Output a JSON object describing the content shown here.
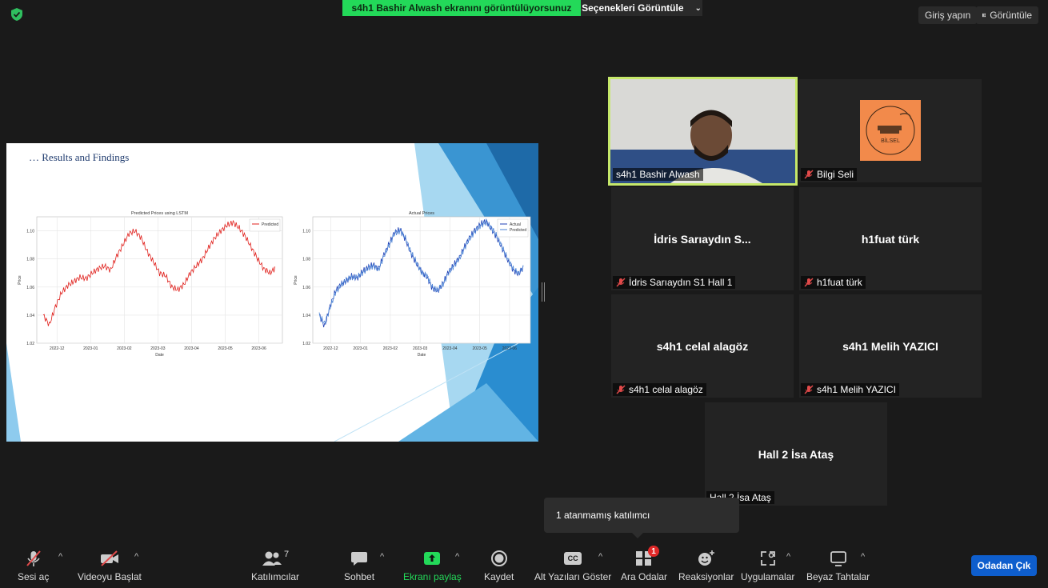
{
  "topbar": {
    "share_banner": "s4h1 Bashir Alwash ekranını görüntülüyorsunuz",
    "view_options": "Seçenekleri Görüntüle",
    "login": "Giriş yapın",
    "view": "Görüntüle"
  },
  "slide": {
    "title": "… Results and Findings",
    "chart_data": [
      {
        "type": "line",
        "title": "Predicted Prices using LSTM",
        "xlabel": "Date",
        "ylabel": "Price",
        "x_ticks": [
          "2022-12",
          "2023-01",
          "2023-02",
          "2023-03",
          "2023-04",
          "2023-05",
          "2023-06"
        ],
        "y_ticks": [
          "1.02",
          "1.04",
          "1.06",
          "1.08",
          "1.10"
        ],
        "ylim": [
          1.02,
          1.11
        ],
        "legend": [
          "Predicted"
        ],
        "legend_position": "top-right",
        "grid": true,
        "series": [
          {
            "name": "Predicted",
            "color": "#e0201c",
            "values": [
              1.04,
              1.033,
              1.046,
              1.056,
              1.061,
              1.064,
              1.067,
              1.066,
              1.07,
              1.073,
              1.075,
              1.072,
              1.082,
              1.09,
              1.098,
              1.1,
              1.095,
              1.085,
              1.078,
              1.07,
              1.068,
              1.06,
              1.058,
              1.062,
              1.07,
              1.075,
              1.08,
              1.088,
              1.095,
              1.1,
              1.104,
              1.106,
              1.102,
              1.096,
              1.088,
              1.08,
              1.073,
              1.07,
              1.074
            ]
          }
        ]
      },
      {
        "type": "line",
        "title": "Actual Prices",
        "xlabel": "Date",
        "ylabel": "Price",
        "x_ticks": [
          "2022-12",
          "2023-01",
          "2023-02",
          "2023-03",
          "2023-04",
          "2023-05",
          "2023-06"
        ],
        "y_ticks": [
          "1.02",
          "1.04",
          "1.06",
          "1.08",
          "1.10"
        ],
        "ylim": [
          1.02,
          1.11
        ],
        "legend": [
          "Actual",
          "Predicted"
        ],
        "legend_position": "top-right",
        "grid": true,
        "series": [
          {
            "name": "Actual",
            "color": "#1f3fb4",
            "values": [
              1.04,
              1.032,
              1.046,
              1.057,
              1.062,
              1.064,
              1.068,
              1.066,
              1.071,
              1.074,
              1.076,
              1.073,
              1.083,
              1.091,
              1.099,
              1.101,
              1.094,
              1.084,
              1.077,
              1.071,
              1.067,
              1.059,
              1.057,
              1.063,
              1.071,
              1.076,
              1.081,
              1.089,
              1.096,
              1.101,
              1.105,
              1.107,
              1.101,
              1.095,
              1.087,
              1.079,
              1.072,
              1.069,
              1.075
            ]
          },
          {
            "name": "Predicted",
            "color": "#4f86d6",
            "values": [
              1.04,
              1.034,
              1.045,
              1.056,
              1.061,
              1.065,
              1.067,
              1.067,
              1.07,
              1.073,
              1.075,
              1.072,
              1.082,
              1.09,
              1.098,
              1.1,
              1.095,
              1.085,
              1.078,
              1.07,
              1.068,
              1.06,
              1.058,
              1.062,
              1.07,
              1.075,
              1.08,
              1.088,
              1.095,
              1.1,
              1.104,
              1.106,
              1.102,
              1.096,
              1.088,
              1.08,
              1.073,
              1.07,
              1.074
            ]
          }
        ]
      }
    ]
  },
  "participants": [
    {
      "label": "s4h1 Bashir Alwash",
      "type": "video"
    },
    {
      "label": "Bilgi Seli",
      "type": "logo",
      "logo_text": "BİLSEL"
    },
    {
      "center": "İdris Sarıaydın S...",
      "label": "İdris Sarıaydın S1 Hall 1"
    },
    {
      "center": "h1fuat türk",
      "label": "h1fuat türk"
    },
    {
      "center": "s4h1 celal alagöz",
      "label": "s4h1 celal alagöz"
    },
    {
      "center": "s4h1 Melih YAZICI",
      "label": "s4h1 Melih YAZICI"
    },
    {
      "center": "Hall 2 İsa Ataş",
      "label": "Hall 2 İsa Ataş"
    }
  ],
  "popup": {
    "text": "1 atanmamış katılımcı"
  },
  "toolbar": {
    "audio": "Sesi aç",
    "video": "Videoyu Başlat",
    "participants": "Katılımcılar",
    "participants_count": "7",
    "chat": "Sohbet",
    "share": "Ekranı paylaş",
    "record": "Kaydet",
    "captions": "Alt Yazıları Göster",
    "captions_icon": "CC",
    "breakout": "Ara Odalar",
    "breakout_badge": "1",
    "reactions": "Reaksiyonlar",
    "apps": "Uygulamalar",
    "whiteboard": "Beyaz Tahtalar",
    "leave": "Odadan Çık"
  },
  "colors": {
    "share_green": "#23d959",
    "leave_blue": "#0e5ecd",
    "speaker_border": "#c6e86a"
  }
}
